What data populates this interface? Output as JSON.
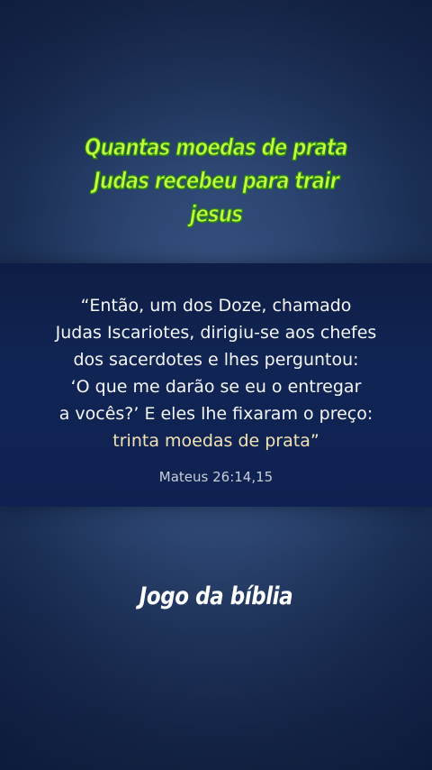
{
  "title_lines": [
    "Quantas moedas de prata",
    "Judas recebeu para trair",
    "jesus"
  ],
  "verse": {
    "lines": [
      "“Então, um dos Doze, chamado",
      "Judas Iscariotes, dirigiu-se aos chefes",
      "dos sacerdotes e lhes perguntou:",
      "‘O que me darão se eu o entregar",
      "a vocês?’ E eles lhe fixaram o preço:"
    ],
    "highlight": "trinta moedas de prata”",
    "reference": "Mateus 26:14,15"
  },
  "footer_title": "Jogo da bíblia",
  "colors": {
    "title": "#c8ff3d",
    "title_outline": "#2f8a1a",
    "highlight": "#f3e2b3",
    "band": "#112555",
    "background": "#2b4470"
  }
}
